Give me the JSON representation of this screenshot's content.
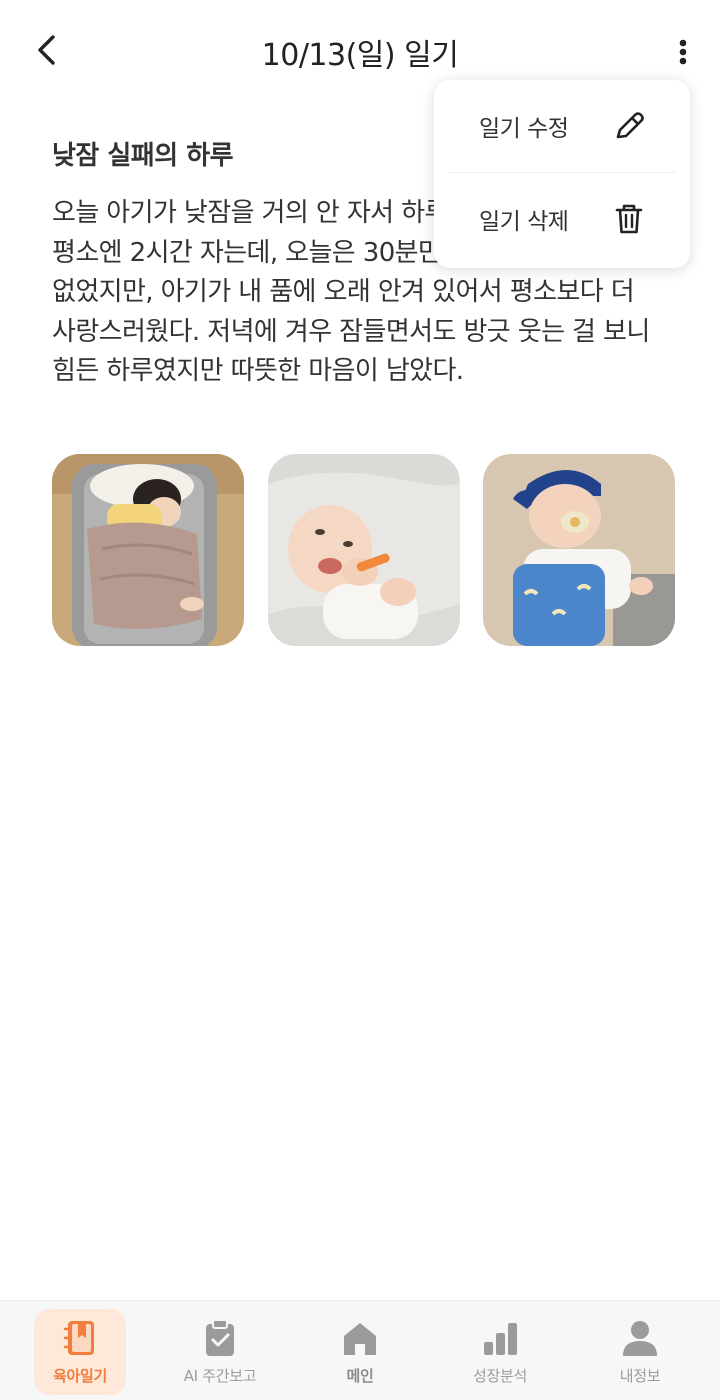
{
  "header": {
    "title": "10/13(일) 일기",
    "back_icon": "chevron-left-icon",
    "more_icon": "more-vertical-icon"
  },
  "diary": {
    "title": "낮잠 실패의 하루",
    "body": "오늘 아기가 낮잠을 거의 안 자서 하루 종일 정신없었다. 평소엔 2시간 자는데, 오늘은 30분만 자서 덕분에 쉴 틈은 없었지만, 아기가 내 품에 오래 안겨 있어서 평소보다 더 사랑스러웠다. 저녁에 겨우 잠들면서도 방긋 웃는 걸 보니 힘든 하루였지만 따뜻한 마음이 남았다."
  },
  "menu": {
    "items": [
      {
        "label": "일기 수정",
        "icon": "pencil-icon"
      },
      {
        "label": "일기 삭제",
        "icon": "trash-icon"
      }
    ]
  },
  "photos": [
    {
      "name": "baby-sleeping-photo"
    },
    {
      "name": "baby-smiling-photo"
    },
    {
      "name": "baby-with-cap-photo"
    }
  ],
  "tabs": [
    {
      "label": "육아일기",
      "icon": "diary-icon",
      "active": true
    },
    {
      "label": "AI 주간보고",
      "icon": "clipboard-check-icon",
      "active": false
    },
    {
      "label": "메인",
      "icon": "home-icon",
      "active": false
    },
    {
      "label": "성장분석",
      "icon": "bar-chart-icon",
      "active": false
    },
    {
      "label": "내정보",
      "icon": "person-icon",
      "active": false
    }
  ],
  "colors": {
    "accent": "#f27d3c",
    "active_tab_bg": "#fde8da",
    "inactive": "#9b9b9b"
  }
}
